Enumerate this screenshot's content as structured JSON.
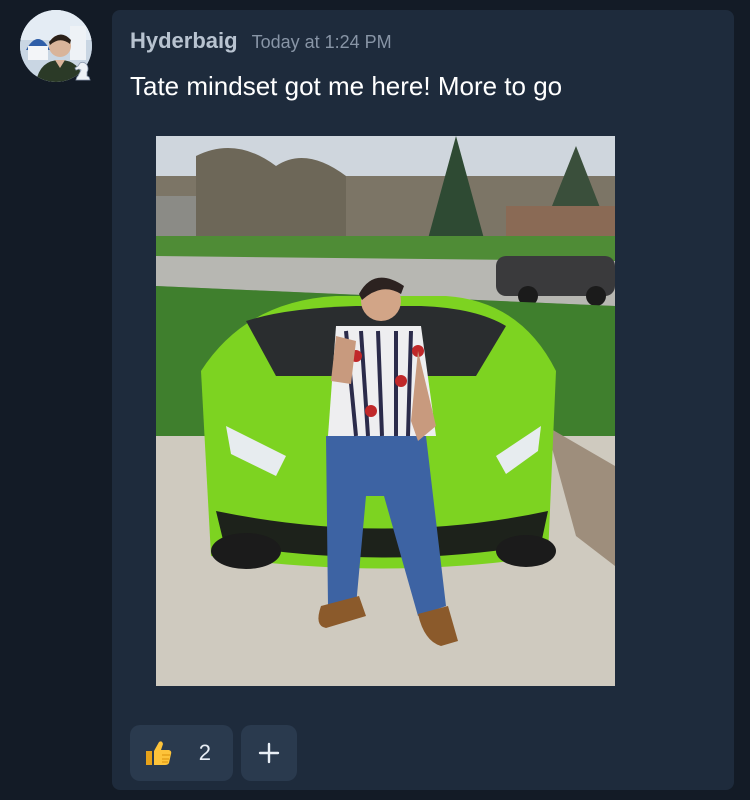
{
  "post": {
    "username": "Hyderbaig",
    "timestamp": "Today at 1:24 PM",
    "message": "Tate mindset got me here! More to go"
  },
  "avatar": {
    "icon": "profile-avatar",
    "badge_icon": "chess-knight-icon"
  },
  "photo": {
    "icon": "photo-attachment"
  },
  "reactions": [
    {
      "icon": "thumbs-up-icon",
      "count": "2"
    },
    {
      "icon": "plus-icon"
    }
  ],
  "colors": {
    "background": "#131b26",
    "card": "#1e2b3c",
    "reaction_bg": "#2a3a4e",
    "username": "#b8c3d0",
    "timestamp": "#8895a6",
    "car_green": "#7dd321"
  }
}
